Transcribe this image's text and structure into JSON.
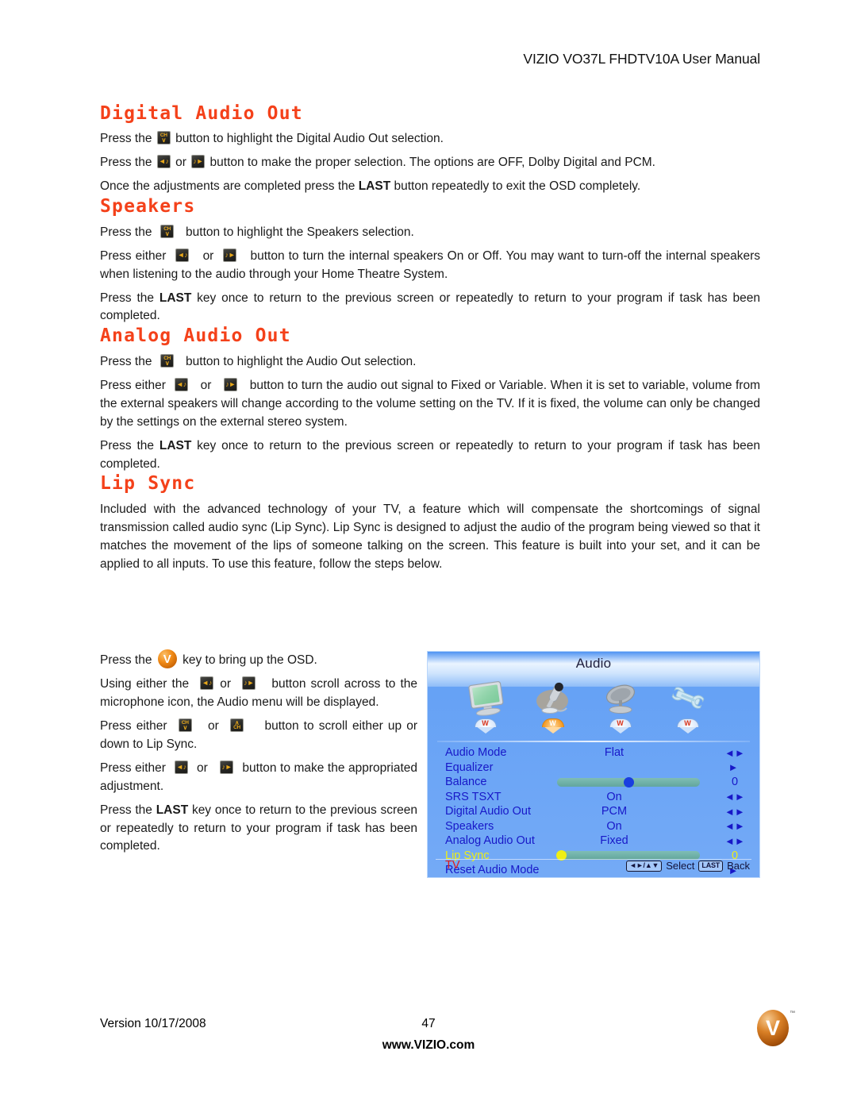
{
  "header": {
    "title": "VIZIO VO37L FHDTV10A User Manual"
  },
  "sections": {
    "digital_audio_out": {
      "heading": "Digital Audio Out",
      "p1_a": "Press the",
      "p1_b": "button to highlight the Digital Audio Out selection.",
      "p2_a": "Press the",
      "p2_or": "or",
      "p2_b": "button to make the proper selection. The options are OFF, Dolby Digital and PCM.",
      "p3_a": "Once the adjustments are completed press the",
      "p3_bold": "LAST",
      "p3_b": "button repeatedly to exit the OSD completely."
    },
    "speakers": {
      "heading": "Speakers",
      "p1_a": "Press the",
      "p1_b": "button to highlight the Speakers selection.",
      "p2_a": "Press either",
      "p2_or": "or",
      "p2_b": "button to turn the internal speakers On or Off.  You may want to turn-off the internal speakers when listening to the audio through your Home Theatre System.",
      "p3_a": "Press the",
      "p3_bold": "LAST",
      "p3_b": "key once to return to the previous screen or repeatedly to return to your program if task has been completed."
    },
    "analog_audio_out": {
      "heading": "Analog Audio Out",
      "p1_a": "Press the",
      "p1_b": "button to highlight the Audio Out selection.",
      "p2_a": "Press either",
      "p2_or": "or",
      "p2_b": "button to turn the audio out signal to Fixed or Variable. When it is set to variable, volume from the external speakers will change according to the volume setting on the TV. If it is fixed, the volume can only be changed by the settings on the external stereo system.",
      "p3_a": "Press the",
      "p3_bold": "LAST",
      "p3_b": "key once to return to the previous screen or repeatedly to return to your program if task has been completed."
    },
    "lip_sync": {
      "heading": "Lip Sync",
      "intro": "Included with the advanced technology of your TV, a feature which will compensate the shortcomings of signal transmission called audio sync (Lip Sync). Lip Sync is designed to adjust the audio of the program being viewed so that it matches the movement of the lips of someone talking on the screen. This feature is built into your set, and it can be applied to all inputs. To use this feature, follow the steps below.",
      "s1_a": "Press the",
      "s1_b": "key to bring up the OSD.",
      "s2_a": "Using either the",
      "s2_or": "or",
      "s2_b": "button scroll across to the microphone icon, the Audio menu will be displayed.",
      "s3_a": "Press either",
      "s3_or": "or",
      "s3_b": "button to scroll either up or down to Lip Sync.",
      "s4_a": "Press either",
      "s4_or": "or",
      "s4_b": "button to make the appropriated adjustment.",
      "s5_a": "Press the",
      "s5_bold": "LAST",
      "s5_b": "key once to return to the previous screen or repeatedly to return to your program if task has been completed."
    }
  },
  "keys": {
    "ch_down": {
      "name": "channel-down-key",
      "top": "CH",
      "bottom": "∨"
    },
    "ch_up": {
      "name": "channel-up-key",
      "top": "∧",
      "bottom": "CH"
    },
    "vol_down": {
      "name": "volume-down-key",
      "glyph": "◄♪"
    },
    "vol_up": {
      "name": "volume-up-key",
      "glyph": "♪►"
    },
    "vizio_menu": {
      "name": "vizio-menu-key",
      "glyph": "V"
    }
  },
  "osd": {
    "title": "Audio",
    "tabs": [
      {
        "name": "picture-tab",
        "icon": "monitor-icon",
        "active": false
      },
      {
        "name": "audio-tab",
        "icon": "microphone-icon",
        "active": true
      },
      {
        "name": "tuner-tab",
        "icon": "satellite-dish-icon",
        "active": false
      },
      {
        "name": "setup-tab",
        "icon": "wrench-icon",
        "active": false
      }
    ],
    "rows": [
      {
        "label": "Audio Mode",
        "value": "Flat",
        "control": "◄►",
        "type": "value",
        "selected": false
      },
      {
        "label": "Equalizer",
        "value": "",
        "control": "►",
        "type": "submenu",
        "selected": false
      },
      {
        "label": "Balance",
        "value": "0",
        "control": "",
        "type": "slider",
        "slider_pct": 50,
        "selected": false
      },
      {
        "label": "SRS TSXT",
        "value": "On",
        "control": "◄►",
        "type": "value",
        "selected": false
      },
      {
        "label": "Digital Audio Out",
        "value": "PCM",
        "control": "◄►",
        "type": "value",
        "selected": false
      },
      {
        "label": "Speakers",
        "value": "On",
        "control": "◄►",
        "type": "value",
        "selected": false
      },
      {
        "label": "Analog Audio Out",
        "value": "Fixed",
        "control": "◄►",
        "type": "value",
        "selected": false
      },
      {
        "label": "Lip Sync",
        "value": "0",
        "control": "",
        "type": "slider",
        "slider_pct": 0,
        "selected": true
      },
      {
        "label": "Reset Audio Mode",
        "value": "",
        "control": "►",
        "type": "submenu",
        "selected": false
      }
    ],
    "source": "TV",
    "hints": {
      "nav_keys": "◄►/▲▼",
      "select": "Select",
      "last_key": "LAST",
      "back": "Back"
    },
    "colors": {
      "panel_blue": "#74aaf6",
      "label_blue": "#1818C8",
      "selected_yellow": "#EFEF15",
      "source_red": "#E01B1B",
      "slider_track": "#62a69d",
      "knob_blue": "#1a3ee0"
    }
  },
  "footer": {
    "version": "Version 10/17/2008",
    "page_number": "47",
    "website": "www.VIZIO.com",
    "logo_tm": "™"
  },
  "theme": {
    "heading_orange": "#F4411A"
  }
}
